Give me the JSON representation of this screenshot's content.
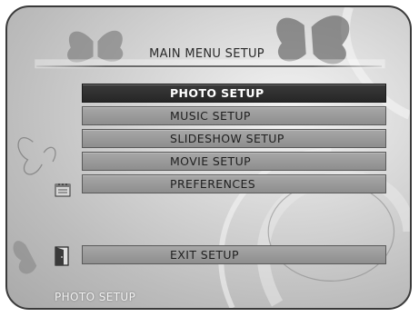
{
  "menu": {
    "title": "MAIN MENU SETUP",
    "items": [
      {
        "label": "PHOTO SETUP",
        "selected": true
      },
      {
        "label": "MUSIC SETUP",
        "selected": false
      },
      {
        "label": "SLIDESHOW SETUP",
        "selected": false
      },
      {
        "label": "MOVIE SETUP",
        "selected": false
      },
      {
        "label": "PREFERENCES",
        "selected": false
      }
    ],
    "exit_label": "EXIT SETUP"
  },
  "status_bar": {
    "text": "PHOTO SETUP"
  },
  "icons": {
    "preferences": "notepad-icon",
    "exit": "exit-door-icon"
  },
  "colors": {
    "selected_bg": "#2f2f2f",
    "item_bg": "#9a9a9a",
    "status_text": "#f2f2f2"
  }
}
